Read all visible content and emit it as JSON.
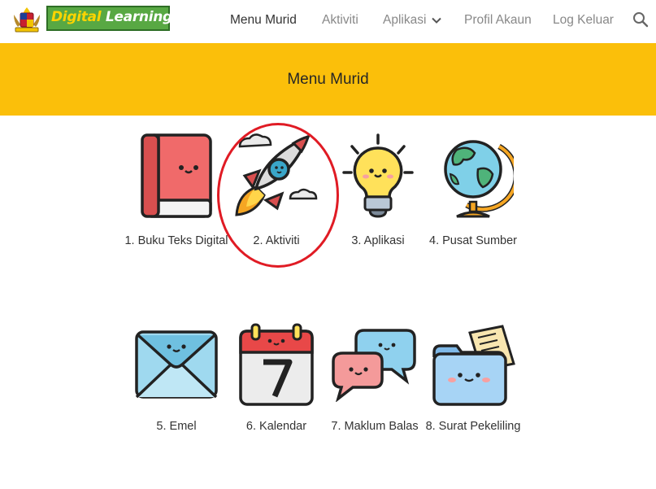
{
  "header": {
    "logo": {
      "part1": "Digital",
      "part2": "Learning"
    },
    "nav": [
      {
        "label": "Menu Murid",
        "active": true
      },
      {
        "label": "Aktiviti",
        "active": false
      },
      {
        "label": "Aplikasi",
        "active": false
      },
      {
        "label": "Profil Akaun",
        "active": false
      },
      {
        "label": "Log Keluar",
        "active": false
      }
    ]
  },
  "banner": {
    "title": "Menu Murid"
  },
  "tiles": [
    {
      "label": "1. Buku Teks Digital",
      "icon": "book-icon"
    },
    {
      "label": "2. Aktiviti",
      "icon": "rocket-icon"
    },
    {
      "label": "3. Aplikasi",
      "icon": "lightbulb-icon"
    },
    {
      "label": "4. Pusat Sumber",
      "icon": "globe-icon"
    },
    {
      "label": "5. Emel",
      "icon": "envelope-icon"
    },
    {
      "label": "6. Kalendar",
      "icon": "calendar-icon"
    },
    {
      "label": "7. Maklum Balas",
      "icon": "chat-bubbles-icon"
    },
    {
      "label": "8. Surat Pekeliling",
      "icon": "folder-icon"
    }
  ],
  "colors": {
    "banner": "#fbbf0a",
    "highlight": "#e01b24",
    "logo_green": "#58a843",
    "logo_yellow": "#ffd400"
  }
}
